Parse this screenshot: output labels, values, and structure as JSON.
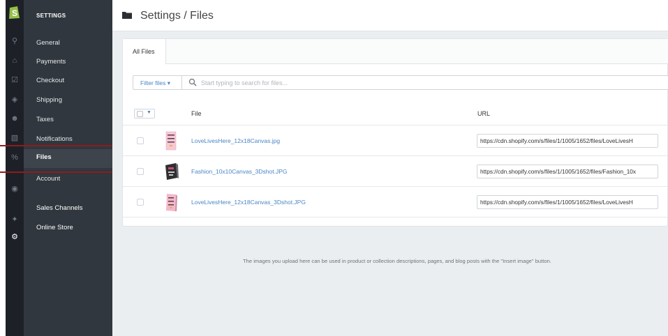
{
  "rail": {
    "icons": [
      "shopify-logo",
      "search-icon",
      "home-icon",
      "orders-icon",
      "tag-icon",
      "customers-icon",
      "reports-icon",
      "discounts-icon",
      "apps-icon",
      "channels-icon",
      "gear-icon"
    ]
  },
  "nav": {
    "title": "SETTINGS",
    "items": [
      {
        "label": "General"
      },
      {
        "label": "Payments"
      },
      {
        "label": "Checkout"
      },
      {
        "label": "Shipping"
      },
      {
        "label": "Taxes"
      },
      {
        "label": "Notifications"
      },
      {
        "label": "Files"
      },
      {
        "label": "Account"
      }
    ],
    "sales_channels_label": "Sales Channels",
    "online_store_label": "Online Store"
  },
  "header": {
    "title": "Settings / Files"
  },
  "tabs": [
    {
      "label": "All Files"
    }
  ],
  "filter": {
    "button_label": "Filter files ▾",
    "placeholder": "Start typing to search for files..."
  },
  "table": {
    "columns": {
      "file": "File",
      "url": "URL"
    },
    "rows": [
      {
        "name": "LoveLivesHere_12x18Canvas.jpg",
        "url": "https://cdn.shopify.com/s/files/1/1005/1652/files/LoveLivesH"
      },
      {
        "name": "Fashion_10x10Canvas_3Dshot.JPG",
        "url": "https://cdn.shopify.com/s/files/1/1005/1652/files/Fashion_10x"
      },
      {
        "name": "LoveLivesHere_12x18Canvas_3Dshot.JPG",
        "url": "https://cdn.shopify.com/s/files/1/1005/1652/files/LoveLivesH"
      }
    ]
  },
  "hint": "The images you upload here can be used in product or collection descriptions, pages, and blog posts with the \"Insert image\" button.",
  "colors": {
    "rail_bg": "#1d2127",
    "nav_bg": "#30373e",
    "accent_link": "#4a86c5",
    "shopify_green": "#95bf47",
    "highlight_red": "#8e1c1c"
  }
}
